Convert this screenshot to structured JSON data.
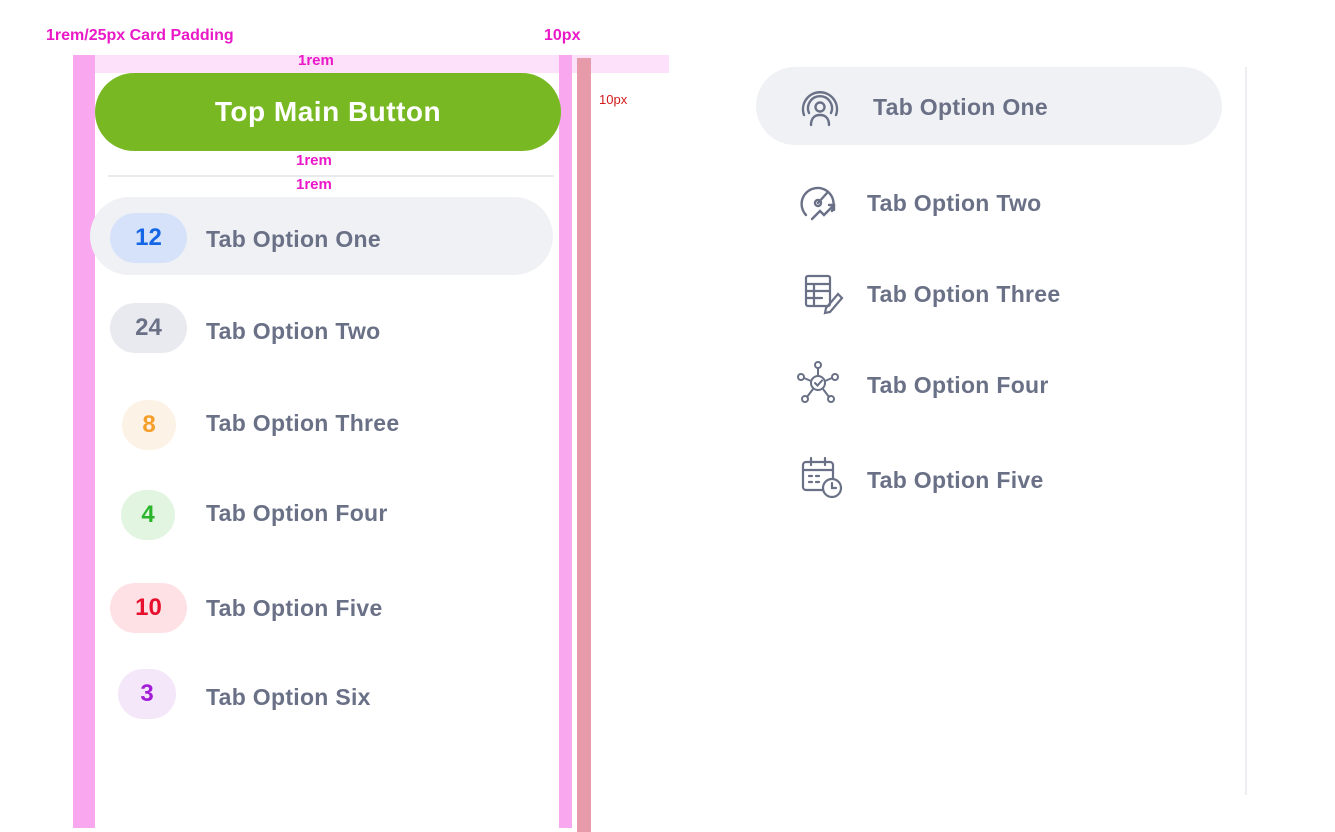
{
  "annotations": {
    "card_padding": "1rem/25px Card Padding",
    "right_px": "10px",
    "top_rem": "1rem",
    "outer_px": "10px",
    "below_button_rem": "1rem",
    "below_divider_rem": "1rem"
  },
  "main_button": {
    "label": "Top Main Button",
    "color": "#78b923"
  },
  "left_tabs": [
    {
      "count": "12",
      "label": "Tab Option One",
      "active": true,
      "badge_bg": "#d5e2f9",
      "badge_fg": "#1466e6"
    },
    {
      "count": "24",
      "label": "Tab Option Two",
      "active": false,
      "badge_bg": "#e9eaef",
      "badge_fg": "#6a7187"
    },
    {
      "count": "8",
      "label": "Tab Option Three",
      "active": false,
      "badge_bg": "#fdf2e6",
      "badge_fg": "#f59e2a"
    },
    {
      "count": "4",
      "label": "Tab Option Four",
      "active": false,
      "badge_bg": "#e1f5e1",
      "badge_fg": "#2bb52b"
    },
    {
      "count": "10",
      "label": "Tab Option Five",
      "active": false,
      "badge_bg": "#fde1e5",
      "badge_fg": "#e8112d"
    },
    {
      "count": "3",
      "label": "Tab Option Six",
      "active": false,
      "badge_bg": "#f4e7fa",
      "badge_fg": "#a21dd8"
    }
  ],
  "right_tabs": [
    {
      "icon": "broadcast-user-icon",
      "label": "Tab Option One",
      "active": true
    },
    {
      "icon": "speedometer-icon",
      "label": "Tab Option Two",
      "active": false
    },
    {
      "icon": "table-edit-icon",
      "label": "Tab Option Three",
      "active": false
    },
    {
      "icon": "network-check-icon",
      "label": "Tab Option Four",
      "active": false
    },
    {
      "icon": "calendar-clock-icon",
      "label": "Tab Option Five",
      "active": false
    }
  ]
}
